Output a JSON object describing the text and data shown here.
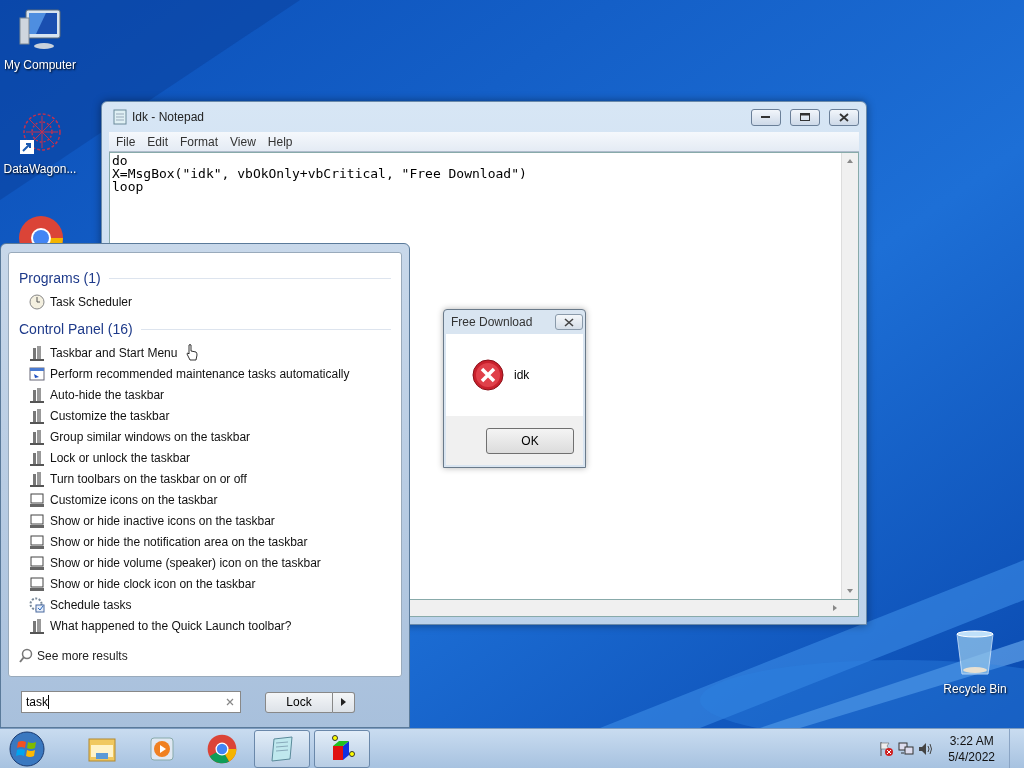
{
  "desktop_icons": [
    {
      "label": "My Computer",
      "kind": "computer"
    },
    {
      "label": "DataWagon...",
      "kind": "datawagon"
    },
    {
      "label": "Recycle Bin",
      "kind": "recycle"
    }
  ],
  "notepad": {
    "title": "Idk - Notepad",
    "menu": [
      "File",
      "Edit",
      "Format",
      "View",
      "Help"
    ],
    "lines": [
      "do",
      "X=MsgBox(\"idk\", vbOkOnly+vbCritical, \"Free Download\")",
      "loop"
    ]
  },
  "start_menu": {
    "groups": [
      {
        "heading": "Programs (1)",
        "items": [
          {
            "label": "Task Scheduler",
            "kind": "clock"
          }
        ]
      },
      {
        "heading": "Control Panel (16)",
        "items": [
          {
            "label": "Taskbar and Start Menu",
            "kind": "tower"
          },
          {
            "label": "Perform recommended maintenance tasks automatically",
            "kind": "maintenance"
          },
          {
            "label": "Auto-hide the taskbar",
            "kind": "tower"
          },
          {
            "label": "Customize the taskbar",
            "kind": "tower"
          },
          {
            "label": "Group similar windows on the taskbar",
            "kind": "tower"
          },
          {
            "label": "Lock or unlock the taskbar",
            "kind": "tower"
          },
          {
            "label": "Turn toolbars on the taskbar on or off",
            "kind": "tower"
          },
          {
            "label": "Customize icons on the taskbar",
            "kind": "monitor"
          },
          {
            "label": "Show or hide inactive icons on the taskbar",
            "kind": "monitor"
          },
          {
            "label": "Show or hide the notification area on the taskbar",
            "kind": "monitor"
          },
          {
            "label": "Show or hide volume (speaker) icon on the taskbar",
            "kind": "monitor"
          },
          {
            "label": "Show or hide clock icon on the taskbar",
            "kind": "monitor"
          },
          {
            "label": "Schedule tasks",
            "kind": "schedule"
          },
          {
            "label": "What happened to the Quick Launch toolbar?",
            "kind": "tower"
          }
        ]
      }
    ],
    "see_more": "See more results",
    "search": {
      "value": "task"
    },
    "power_button": "Lock"
  },
  "dialog": {
    "title": "Free Download",
    "message": "idk",
    "button": "OK"
  },
  "taskbar": {
    "apps": [
      {
        "kind": "explorer",
        "running": false
      },
      {
        "kind": "media",
        "running": false
      },
      {
        "kind": "chrome",
        "running": false
      },
      {
        "kind": "notepad",
        "running": true
      },
      {
        "kind": "cube",
        "running": true
      }
    ],
    "clock": {
      "time": "3:22 AM",
      "date": "5/4/2022"
    }
  }
}
